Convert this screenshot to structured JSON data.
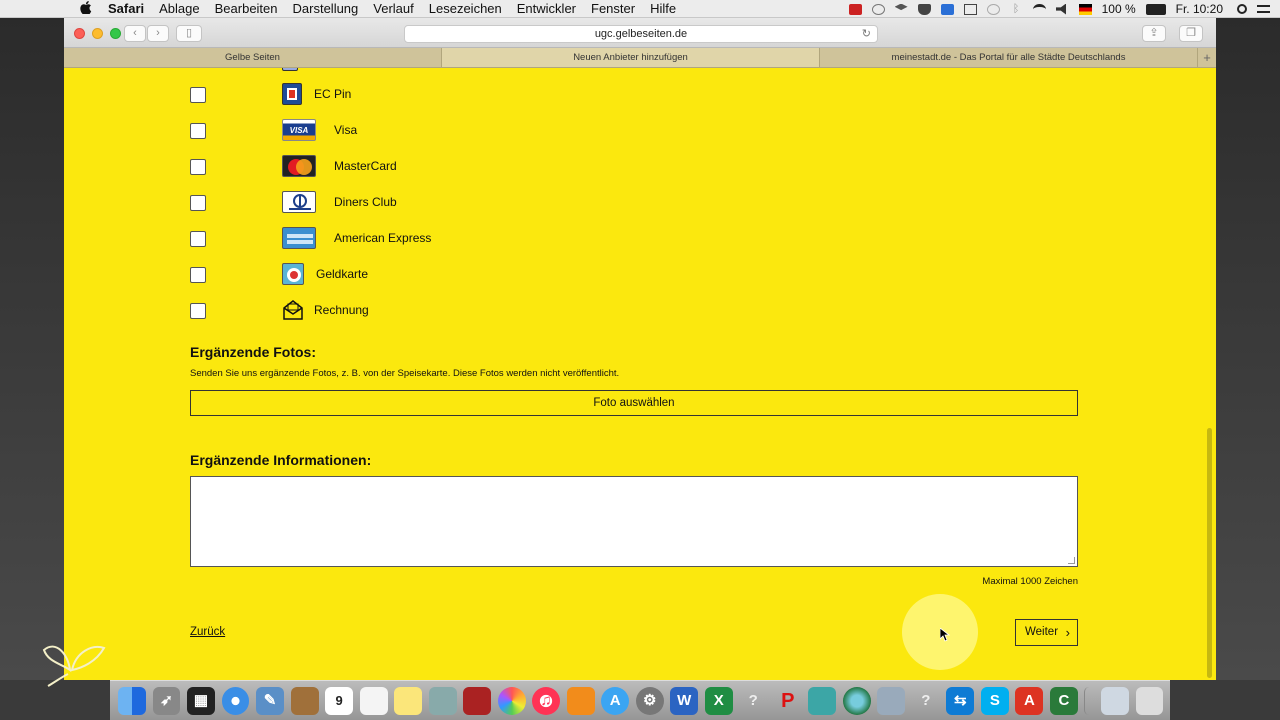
{
  "menubar": {
    "apple": "",
    "items": [
      "Safari",
      "Ablage",
      "Bearbeiten",
      "Darstellung",
      "Verlauf",
      "Lesezeichen",
      "Entwickler",
      "Fenster",
      "Hilfe"
    ],
    "battery": "100 %",
    "clock": "Fr. 10:20"
  },
  "browser": {
    "url": "ugc.gelbeseiten.de",
    "tabs": [
      "Gelbe Seiten",
      "Neuen Anbieter hinzufügen",
      "meinestadt.de - Das Portal für alle Städte Deutschlands"
    ],
    "active_tab": 1
  },
  "payment_options": [
    {
      "label": "EC Pin",
      "icon": "ec-pin-icon"
    },
    {
      "label": "Visa",
      "icon": "visa-icon"
    },
    {
      "label": "MasterCard",
      "icon": "mastercard-icon"
    },
    {
      "label": "Diners Club",
      "icon": "diners-club-icon"
    },
    {
      "label": "American Express",
      "icon": "american-express-icon"
    },
    {
      "label": "Geldkarte",
      "icon": "geldkarte-icon"
    },
    {
      "label": "Rechnung",
      "icon": "rechnung-icon"
    }
  ],
  "photos": {
    "heading": "Ergänzende Fotos:",
    "description": "Senden Sie uns ergänzende Fotos, z. B. von der Speisekarte. Diese Fotos werden nicht veröffentlicht.",
    "button": "Foto auswählen"
  },
  "info": {
    "heading": "Ergänzende Informationen:",
    "value": "",
    "max_chars": "Maximal 1000 Zeichen"
  },
  "nav": {
    "back": "Zurück",
    "next": "Weiter"
  },
  "colors": {
    "page_background": "#fbe80e",
    "tab_bar": "#cfc39a"
  }
}
